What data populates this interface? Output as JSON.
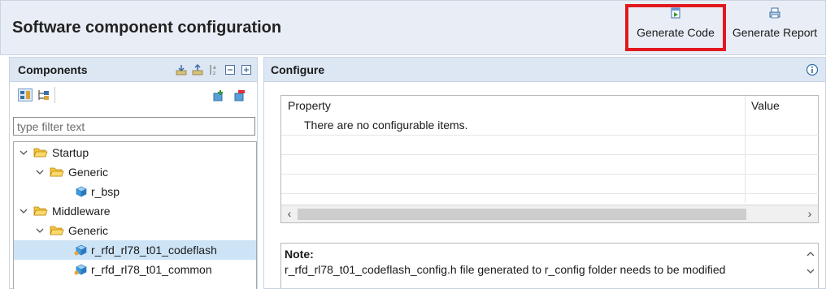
{
  "header": {
    "title": "Software component configuration",
    "generate_code_label": "Generate Code",
    "generate_report_label": "Generate Report",
    "highlight_color": "#e1191e"
  },
  "components_panel": {
    "title": "Components",
    "header_icons": [
      "add-component-icon",
      "remove-component-icon",
      "sort-az-icon",
      "collapse-all-icon",
      "expand-all-icon"
    ],
    "view_icons": [
      "category-view-icon",
      "hierarchy-view-icon"
    ],
    "action_icons": [
      "add-icon",
      "remove-icon"
    ],
    "filter_placeholder": "type filter text",
    "tree": [
      {
        "label": "Startup",
        "type": "folder",
        "expanded": true,
        "level": 0
      },
      {
        "label": "Generic",
        "type": "folder",
        "expanded": true,
        "level": 1
      },
      {
        "label": "r_bsp",
        "type": "component",
        "level": 2
      },
      {
        "label": "Middleware",
        "type": "folder",
        "expanded": true,
        "level": 0
      },
      {
        "label": "Generic",
        "type": "folder",
        "expanded": true,
        "level": 1
      },
      {
        "label": "r_rfd_rl78_t01_codeflash",
        "type": "component",
        "level": 2,
        "selected": true
      },
      {
        "label": "r_rfd_rl78_t01_common",
        "type": "component",
        "level": 2
      }
    ]
  },
  "configure_panel": {
    "title": "Configure",
    "columns": [
      "Property",
      "Value"
    ],
    "empty_message": "There are no configurable items.",
    "note_label": "Note:",
    "note_text": "r_rfd_rl78_t01_codeflash_config.h file generated to r_config folder needs to be modified"
  },
  "colors": {
    "header_bg": "#e9eef6",
    "panel_header_bg": "#dde6f3",
    "selection_bg": "#cde4f7",
    "folder_fill": "#f5c542"
  }
}
